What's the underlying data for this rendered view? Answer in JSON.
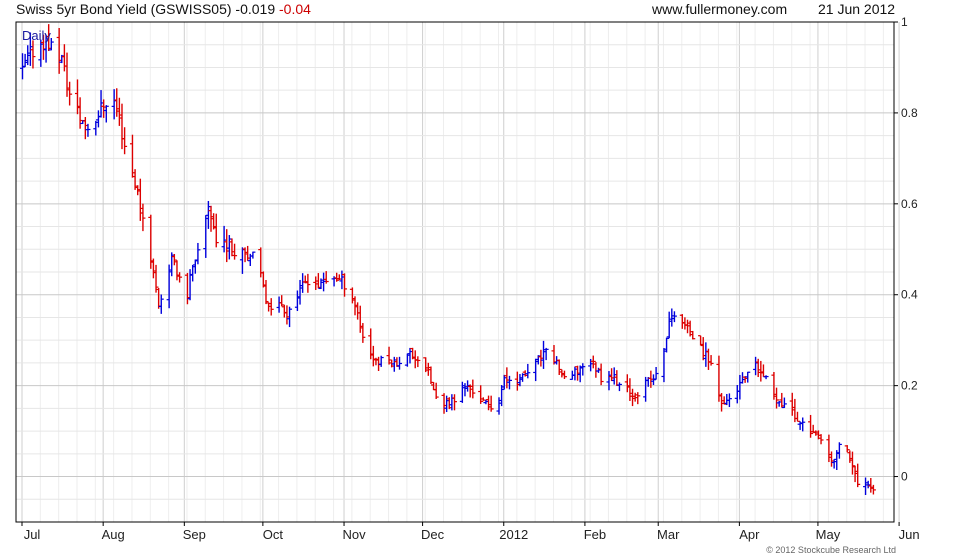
{
  "header": {
    "title": "Swiss 5yr Bond Yield (GSWISS05)",
    "last": "-0.019",
    "change": "-0.04",
    "site": "www.fullermoney.com",
    "date": "21 Jun 2012"
  },
  "copyright": "© 2012 Stockcube Research Ltd",
  "colors": {
    "up": "#0000dd",
    "down": "#dd0000",
    "grid": "#d8d8d8",
    "axis": "#000000"
  },
  "chart_data": {
    "type": "ohlc",
    "interval_label": "Daily",
    "ylim": [
      -0.1,
      1.0
    ],
    "y_ticks": [
      0,
      0.2,
      0.4,
      0.6,
      0.8,
      1
    ],
    "y_tick_labels": [
      "0",
      "0.2",
      "0.4",
      "0.6",
      "0.8",
      "1"
    ],
    "x_labels": [
      "Jul",
      "Aug",
      "Sep",
      "Oct",
      "Nov",
      "Dec",
      "2012",
      "Feb",
      "Mar",
      "Apr",
      "May",
      "Jun"
    ],
    "grid": true,
    "series": [
      {
        "type": "close_path",
        "points": [
          [
            0,
            0.89
          ],
          [
            3,
            0.93
          ],
          [
            6,
            0.95
          ],
          [
            9,
            0.96
          ],
          [
            12,
            0.94
          ],
          [
            15,
            0.92
          ],
          [
            18,
            0.84
          ],
          [
            22,
            0.79
          ],
          [
            25,
            0.77
          ],
          [
            28,
            0.79
          ],
          [
            31,
            0.82
          ],
          [
            34,
            0.84
          ],
          [
            36,
            0.81
          ],
          [
            39,
            0.73
          ],
          [
            42,
            0.67
          ],
          [
            45,
            0.6
          ],
          [
            48,
            0.51
          ],
          [
            50,
            0.45
          ],
          [
            52,
            0.38
          ],
          [
            54,
            0.41
          ],
          [
            57,
            0.48
          ],
          [
            60,
            0.44
          ],
          [
            62,
            0.36
          ],
          [
            64,
            0.44
          ],
          [
            66,
            0.47
          ],
          [
            69,
            0.53
          ],
          [
            71,
            0.6
          ],
          [
            73,
            0.55
          ],
          [
            75,
            0.48
          ],
          [
            77,
            0.52
          ],
          [
            80,
            0.5
          ],
          [
            83,
            0.51
          ],
          [
            86,
            0.49
          ],
          [
            89,
            0.48
          ],
          [
            91,
            0.44
          ],
          [
            93,
            0.39
          ],
          [
            96,
            0.37
          ],
          [
            99,
            0.38
          ],
          [
            101,
            0.36
          ],
          [
            104,
            0.39
          ],
          [
            107,
            0.42
          ],
          [
            110,
            0.44
          ],
          [
            113,
            0.42
          ],
          [
            116,
            0.43
          ],
          [
            119,
            0.44
          ],
          [
            122,
            0.43
          ],
          [
            125,
            0.41
          ],
          [
            128,
            0.36
          ],
          [
            130,
            0.31
          ],
          [
            133,
            0.27
          ],
          [
            136,
            0.25
          ],
          [
            139,
            0.26
          ],
          [
            142,
            0.25
          ],
          [
            145,
            0.26
          ],
          [
            148,
            0.27
          ],
          [
            151,
            0.26
          ],
          [
            154,
            0.24
          ],
          [
            156,
            0.21
          ],
          [
            158,
            0.17
          ],
          [
            160,
            0.15
          ],
          [
            163,
            0.16
          ],
          [
            166,
            0.18
          ],
          [
            169,
            0.2
          ],
          [
            172,
            0.19
          ],
          [
            175,
            0.17
          ],
          [
            178,
            0.15
          ],
          [
            181,
            0.16
          ],
          [
            184,
            0.21
          ],
          [
            187,
            0.22
          ],
          [
            190,
            0.21
          ],
          [
            193,
            0.23
          ],
          [
            196,
            0.25
          ],
          [
            199,
            0.27
          ],
          [
            202,
            0.27
          ],
          [
            205,
            0.24
          ],
          [
            207,
            0.21
          ],
          [
            210,
            0.22
          ],
          [
            213,
            0.24
          ],
          [
            216,
            0.26
          ],
          [
            219,
            0.24
          ],
          [
            221,
            0.22
          ],
          [
            224,
            0.23
          ],
          [
            227,
            0.21
          ],
          [
            230,
            0.19
          ],
          [
            233,
            0.18
          ],
          [
            236,
            0.19
          ],
          [
            239,
            0.21
          ],
          [
            242,
            0.22
          ],
          [
            245,
            0.28
          ],
          [
            247,
            0.34
          ],
          [
            249,
            0.36
          ],
          [
            251,
            0.35
          ],
          [
            253,
            0.33
          ],
          [
            256,
            0.31
          ],
          [
            259,
            0.28
          ],
          [
            262,
            0.26
          ],
          [
            264,
            0.23
          ],
          [
            266,
            0.18
          ],
          [
            268,
            0.16
          ],
          [
            271,
            0.18
          ],
          [
            274,
            0.2
          ],
          [
            277,
            0.22
          ],
          [
            280,
            0.24
          ],
          [
            283,
            0.22
          ],
          [
            286,
            0.19
          ],
          [
            289,
            0.17
          ],
          [
            291,
            0.16
          ],
          [
            294,
            0.14
          ],
          [
            297,
            0.12
          ],
          [
            300,
            0.11
          ],
          [
            303,
            0.09
          ],
          [
            306,
            0.06
          ],
          [
            309,
            0.03
          ],
          [
            311,
            0.05
          ],
          [
            313,
            0.08
          ],
          [
            315,
            0.06
          ],
          [
            317,
            0.02
          ],
          [
            319,
            -0.02
          ],
          [
            321,
            -0.03
          ],
          [
            323,
            -0.01
          ],
          [
            325,
            -0.02
          ]
        ]
      }
    ]
  }
}
